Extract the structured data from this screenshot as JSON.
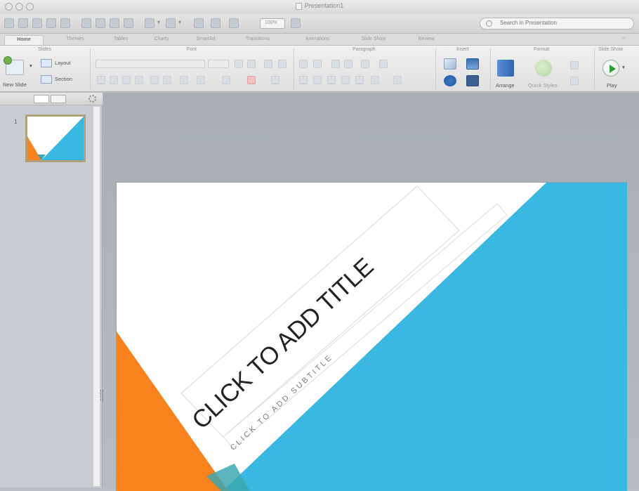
{
  "window": {
    "title": "Presentation1"
  },
  "toolbar": {
    "zoom_value": "100%",
    "search_placeholder": "Search in Presentation"
  },
  "ribbon_tabs": [
    {
      "label": "Home",
      "active": true
    },
    {
      "label": "Themes"
    },
    {
      "label": "Tables"
    },
    {
      "label": "Charts"
    },
    {
      "label": "SmartArt"
    },
    {
      "label": "Transitions"
    },
    {
      "label": "Animations"
    },
    {
      "label": "Slide Show"
    },
    {
      "label": "Review"
    }
  ],
  "ribbon": {
    "groups": {
      "slides": "Slides",
      "font": "Font",
      "paragraph": "Paragraph",
      "insert": "Insert",
      "format": "Format",
      "slide_show": "Slide Show"
    },
    "new_slide_label": "New Slide",
    "layout_label": "Layout",
    "section_label": "Section",
    "arrange_label": "Arrange",
    "quick_styles_label": "Quick Styles",
    "play_label": "Play"
  },
  "slides_pane": {
    "thumbnail_number": "1"
  },
  "slide": {
    "title_placeholder": "CLICK TO ADD TITLE",
    "subtitle_placeholder": "CLICK TO ADD SUBTITLE"
  },
  "colors": {
    "blue": "#3ab8e2",
    "orange": "#f7821e",
    "teal": "#3ea7b0"
  }
}
